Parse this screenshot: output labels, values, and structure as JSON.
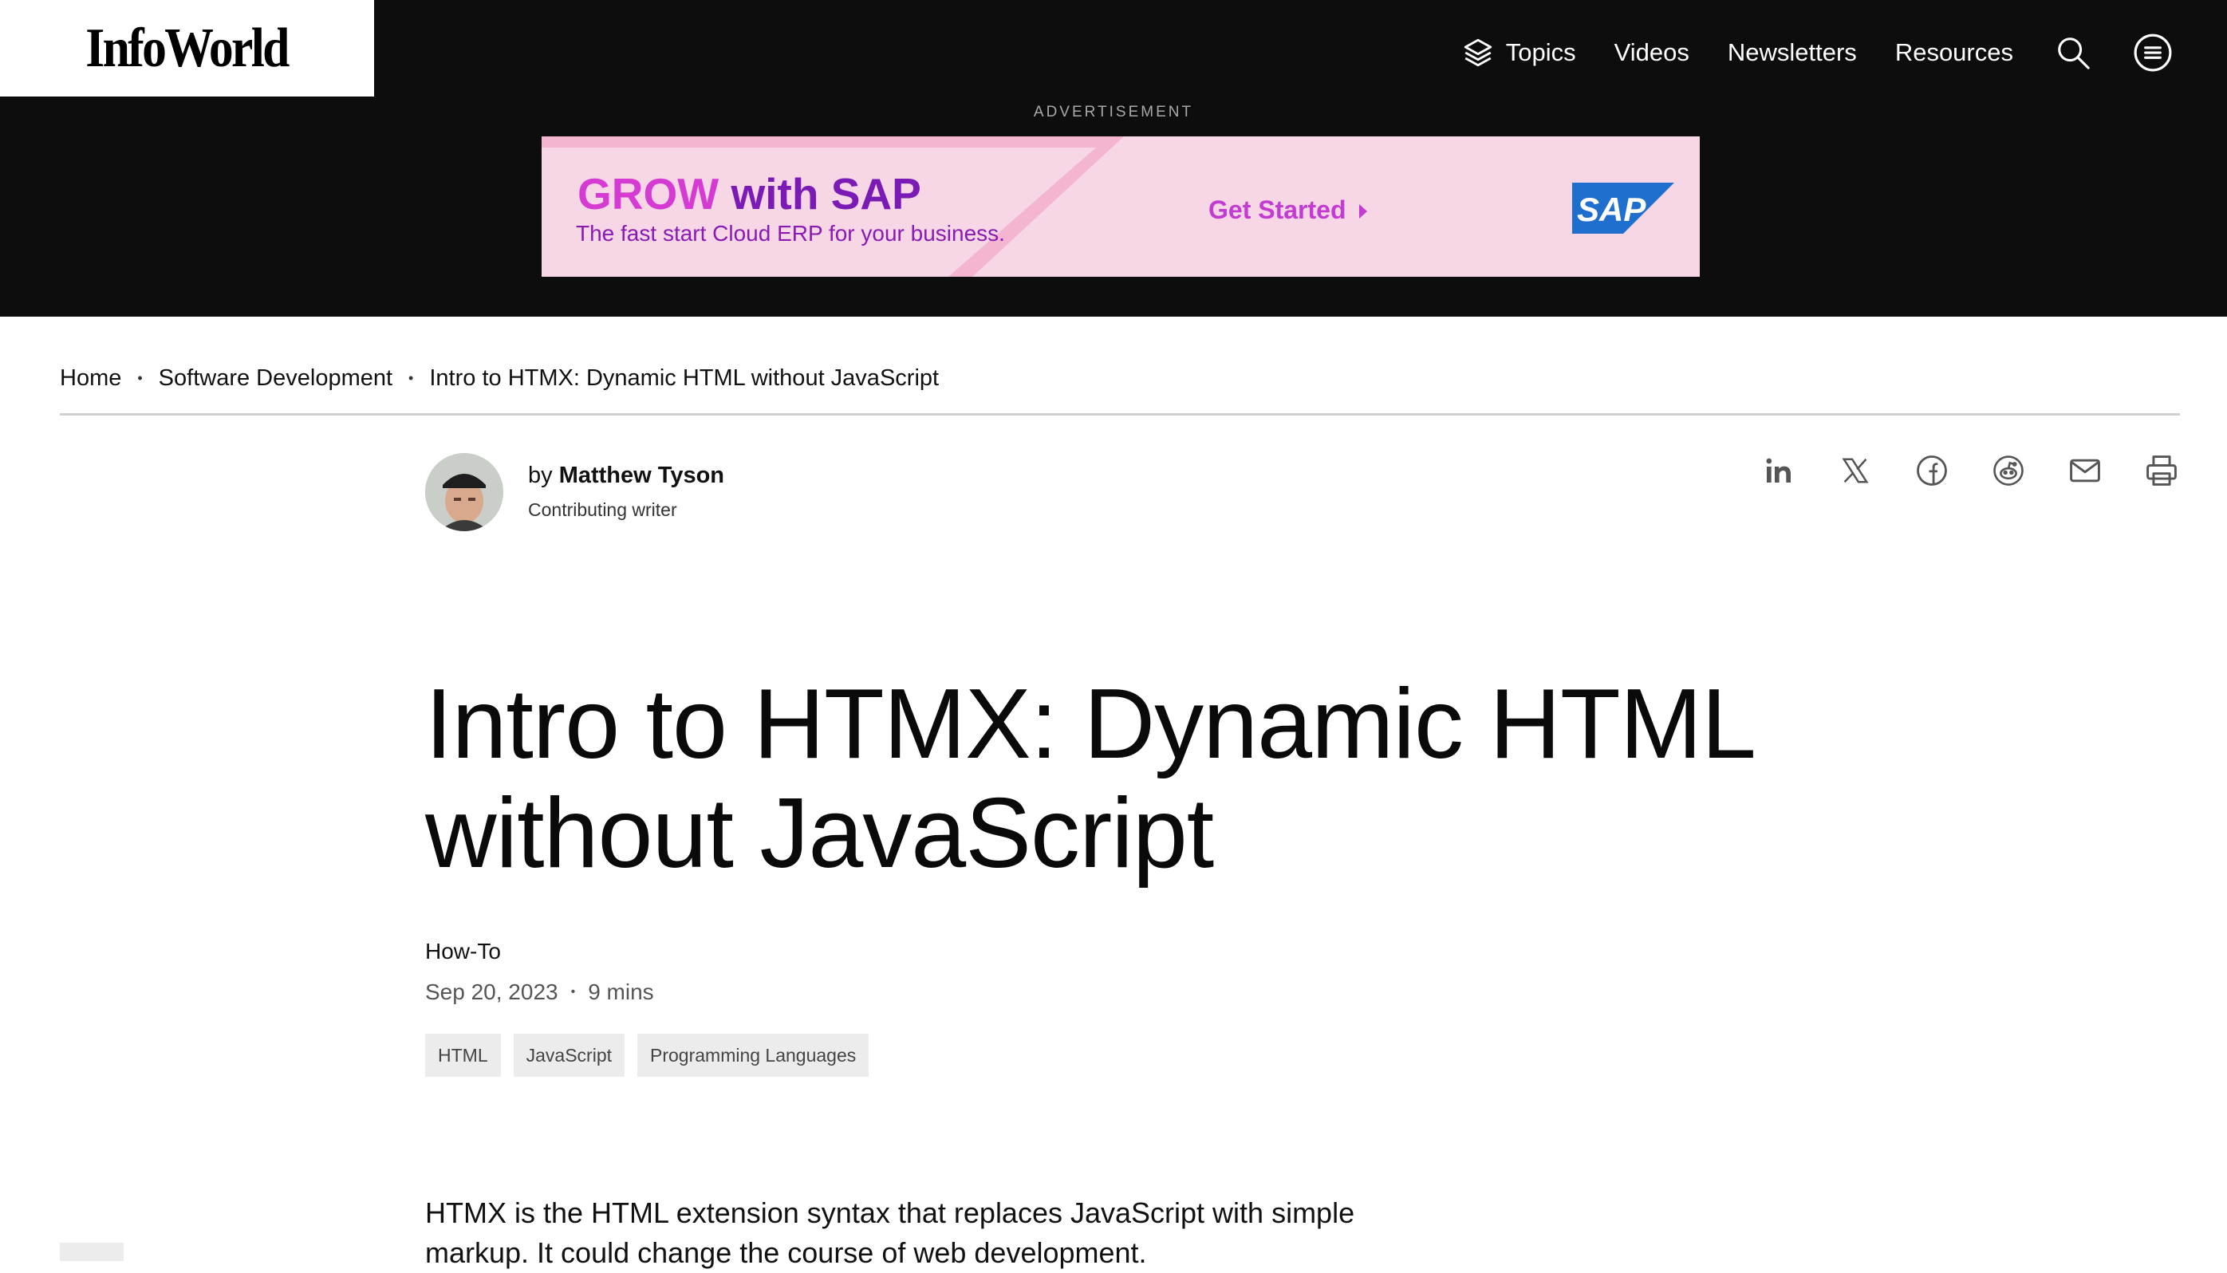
{
  "header": {
    "logo": "InfoWorld",
    "nav": [
      {
        "label": "Topics",
        "icon": "layers-icon"
      },
      {
        "label": "Videos"
      },
      {
        "label": "Newsletters"
      },
      {
        "label": "Resources"
      }
    ],
    "icons": [
      "search-icon",
      "menu-icon"
    ]
  },
  "ad": {
    "label": "ADVERTISEMENT",
    "headline_grow": "GROW",
    "headline_rest": "with SAP",
    "subline": "The fast start Cloud ERP for your business.",
    "cta": "Get Started",
    "brand_logo_text": "SAP",
    "colors": {
      "background": "#f7d6e6",
      "grow": "#d53bd2",
      "text": "#7a1bb6",
      "brand": "#1f6fcf"
    }
  },
  "breadcrumb": {
    "items": [
      "Home",
      "Software Development",
      "Intro to HTMX: Dynamic HTML without JavaScript"
    ]
  },
  "author": {
    "by": "by",
    "name": "Matthew Tyson",
    "role": "Contributing writer"
  },
  "share_icons": [
    "linkedin-icon",
    "x-icon",
    "facebook-icon",
    "reddit-icon",
    "email-icon",
    "print-icon"
  ],
  "article": {
    "title_line1": "Intro to HTMX: Dynamic HTML",
    "title_line2": "without JavaScript",
    "kicker": "How-To",
    "date": "Sep 20, 2023",
    "read_time": "9 mins",
    "tags": [
      "HTML",
      "JavaScript",
      "Programming Languages"
    ],
    "lead": "HTMX is the HTML extension syntax that replaces JavaScript with simple markup. It could change the course of web development."
  }
}
